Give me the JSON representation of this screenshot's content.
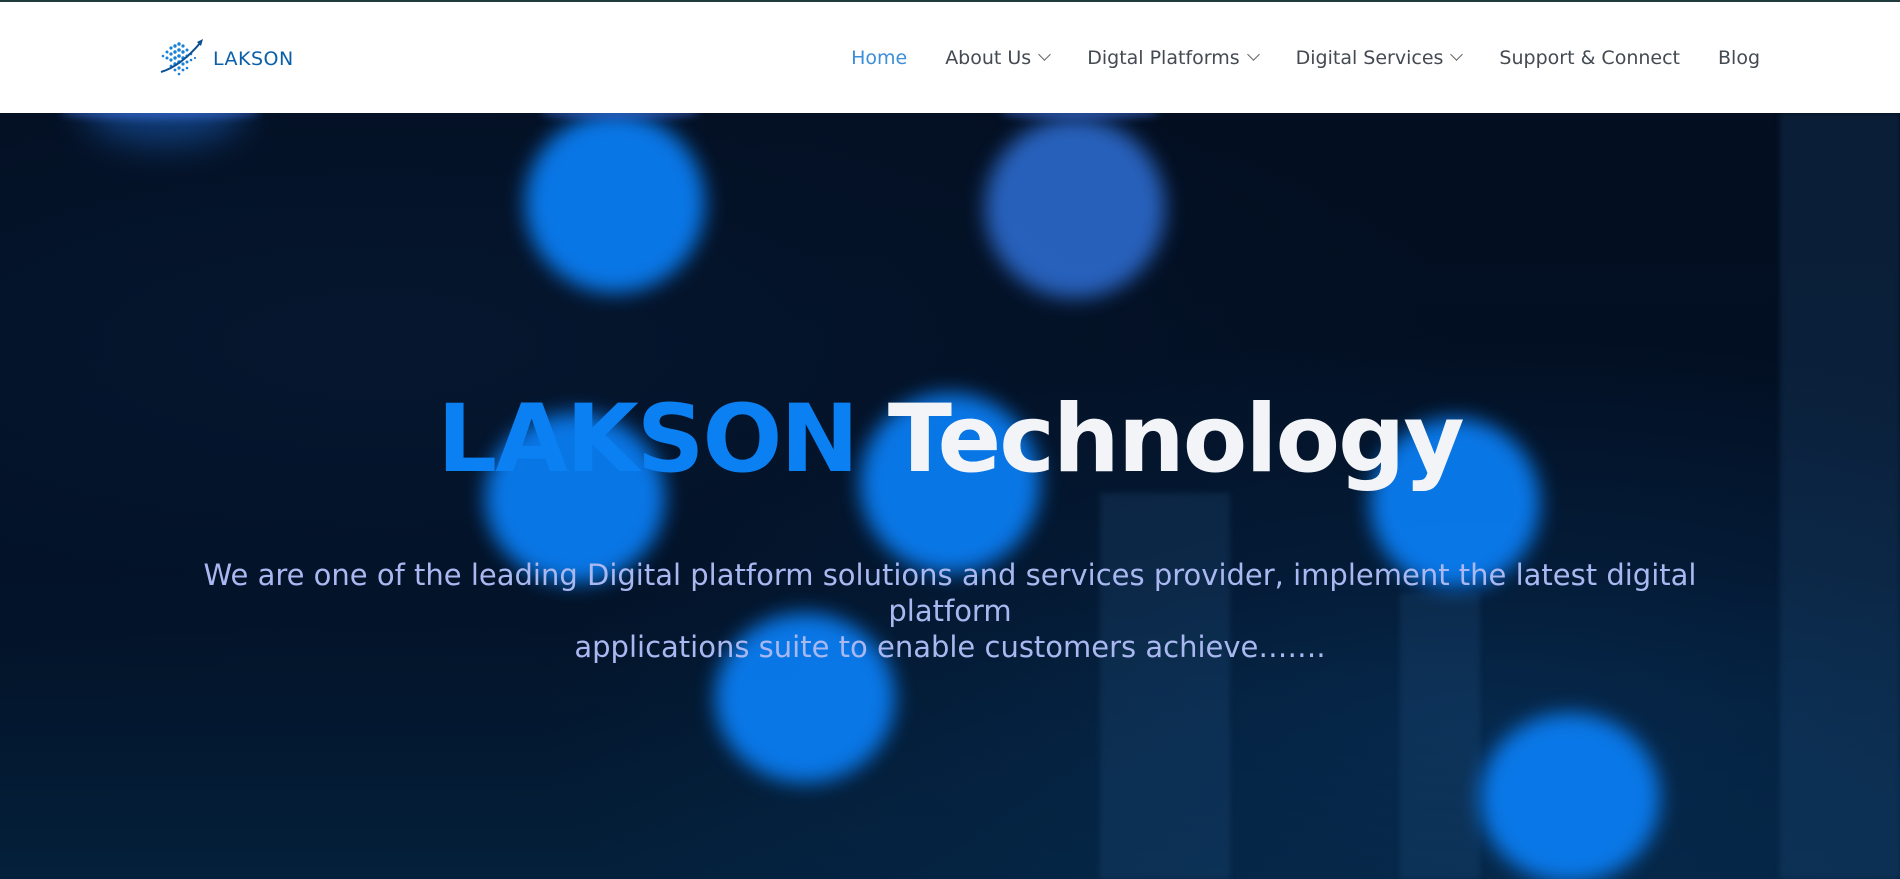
{
  "header": {
    "logo_text": "LAKSON",
    "nav": [
      {
        "label": "Home",
        "active": true,
        "dropdown": false
      },
      {
        "label": "About Us",
        "active": false,
        "dropdown": true
      },
      {
        "label": "Digtal Platforms",
        "active": false,
        "dropdown": true
      },
      {
        "label": "Digital Services",
        "active": false,
        "dropdown": true
      },
      {
        "label": "Support & Connect",
        "active": false,
        "dropdown": false
      },
      {
        "label": "Blog",
        "active": false,
        "dropdown": false
      }
    ]
  },
  "hero": {
    "title_brand": "LAKSON",
    "title_rest": "Technology",
    "subtitle_line1": "We are one of the leading Digital platform solutions and services provider, implement the latest digital platform",
    "subtitle_line2": "applications suite to enable customers achieve……."
  },
  "colors": {
    "brand_blue": "#0a80f2",
    "nav_active": "#3b8fd9",
    "nav_text": "#444a52",
    "hero_bg": "#020b1a",
    "subtitle": "#a9b8f0"
  },
  "icons": {
    "logo": "lakson-logo-icon",
    "dropdown": "chevron-down-icon"
  }
}
